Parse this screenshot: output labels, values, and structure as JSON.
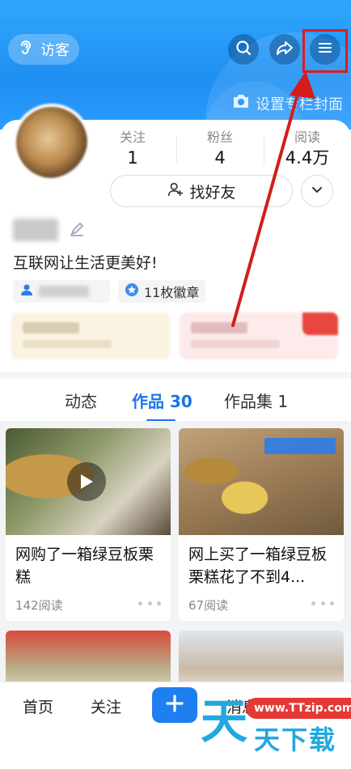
{
  "header": {
    "visitor_label": "访客",
    "cover_label": "设置专栏封面"
  },
  "stats": [
    {
      "label": "关注",
      "value": "1"
    },
    {
      "label": "粉丝",
      "value": "4"
    },
    {
      "label": "阅读",
      "value": "4.4万"
    }
  ],
  "profile": {
    "find_friends_label": "找好友",
    "bio": "互联网让生活更美好!",
    "badge_label": "11枚徽章"
  },
  "tabs": [
    {
      "label": "动态"
    },
    {
      "label": "作品 30"
    },
    {
      "label": "作品集 1"
    }
  ],
  "feed": [
    {
      "title": "网购了一箱绿豆板栗糕",
      "reads": "142阅读"
    },
    {
      "title": "网上买了一箱绿豆板栗糕花了不到4...",
      "reads": "67阅读"
    }
  ],
  "bottom_nav": {
    "home": "首页",
    "follow": "关注",
    "messages": "消息"
  },
  "watermark": {
    "url": "www.TTzip.com",
    "big": "天",
    "text": "天下载"
  },
  "colors": {
    "header_blue": "#1f8ff0",
    "active_tab": "#1a73e8",
    "highlight_red": "#e01b1b"
  }
}
